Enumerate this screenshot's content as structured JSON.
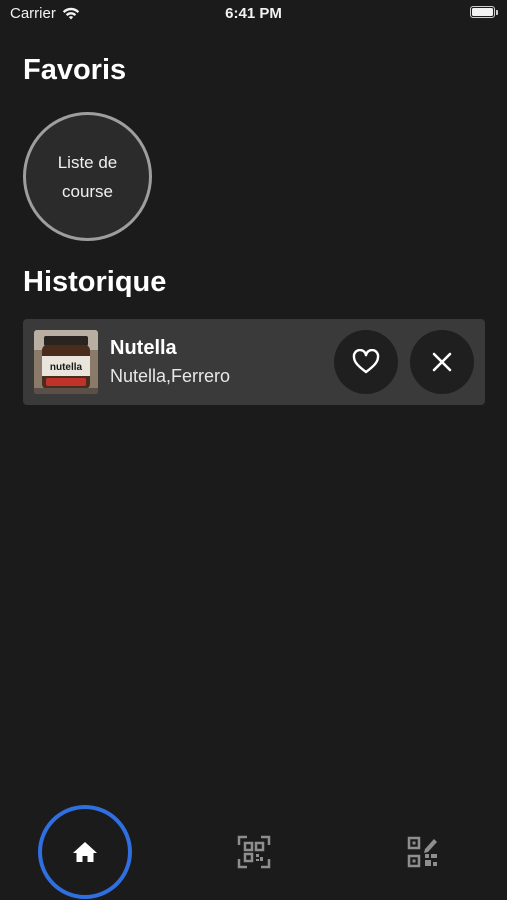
{
  "status_bar": {
    "carrier": "Carrier",
    "time": "6:41 PM",
    "icons": [
      "wifi-icon",
      "battery-icon"
    ]
  },
  "favorites": {
    "title": "Favoris",
    "items": [
      {
        "label": "Liste de course"
      }
    ]
  },
  "history": {
    "title": "Historique",
    "items": [
      {
        "name": "Nutella",
        "brands": "Nutella,Ferrero",
        "thumbnail_label": "nutella",
        "actions": [
          "heart-icon",
          "close-icon"
        ]
      }
    ]
  },
  "tab_bar": {
    "tabs": [
      {
        "icon": "home-icon",
        "selected": true
      },
      {
        "icon": "qr-scan-icon",
        "selected": false
      },
      {
        "icon": "qr-edit-icon",
        "selected": false
      }
    ]
  },
  "colors": {
    "background": "#1b1b1b",
    "card": "#3a3a3a",
    "button": "#1f1f1f",
    "circle_border": "#9e9e9e",
    "active_tab_ring": "#2f6fe0",
    "text": "#ffffff"
  }
}
